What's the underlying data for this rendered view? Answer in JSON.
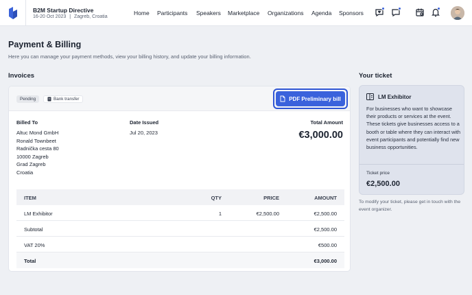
{
  "header": {
    "event_title": "B2M Startup Directive",
    "event_dates": "16-20 Oct 2023",
    "event_sep": "|",
    "event_location": "Zagreb, Croatia",
    "nav": [
      {
        "label": "Home"
      },
      {
        "label": "Participants"
      },
      {
        "label": "Speakers"
      },
      {
        "label": "Marketplace"
      },
      {
        "label": "Organizations"
      },
      {
        "label": "Agenda"
      },
      {
        "label": "Sponsors"
      }
    ],
    "icons": [
      "heart-chat-icon",
      "message-icon",
      "calendar-icon",
      "bell-icon"
    ],
    "accent_color": "#3b63d9"
  },
  "page": {
    "title": "Payment & Billing",
    "description": "Here you can manage your payment methods, view your billing history, and update your billing information."
  },
  "invoices": {
    "section_title": "Invoices",
    "status_badge": "Pending",
    "payment_badge": "Bank transfer",
    "pdf_button_label": "PDF Preliminary bill",
    "billed_to_label": "Billed To",
    "billed_to_lines": [
      "Altuc Mond GmbH",
      "Ronald Townbeet",
      "Radnička cesta 80",
      "10000 Zagreb",
      "Grad Zagreb",
      "Croatia"
    ],
    "date_label": "Date Issued",
    "date_value": "Jul 20, 2023",
    "total_label": "Total Amount",
    "total_value": "€3,000.00",
    "table": {
      "headers": {
        "item": "ITEM",
        "qty": "QTY",
        "price": "PRICE",
        "amount": "AMOUNT"
      },
      "rows": [
        {
          "item": "LM Exhibitor",
          "qty": "1",
          "price": "€2,500.00",
          "amount": "€2,500.00"
        }
      ],
      "subtotal_label": "Subtotal",
      "subtotal_value": "€2,500.00",
      "vat_label": "VAT 20%",
      "vat_value": "€500.00",
      "total_label": "Total",
      "total_value": "€3,000.00"
    }
  },
  "ticket": {
    "section_title": "Your ticket",
    "name": "LM Exhibitor",
    "description": "For businesses who want to showcase their products or services at the event. These tickets give businesses access to a booth or table where they can interact with event participants and potentially find new business opportunities.",
    "price_label": "Ticket price",
    "price_value": "€2,500.00",
    "note": "To modify your ticket, please get in touch with the event organizer."
  }
}
